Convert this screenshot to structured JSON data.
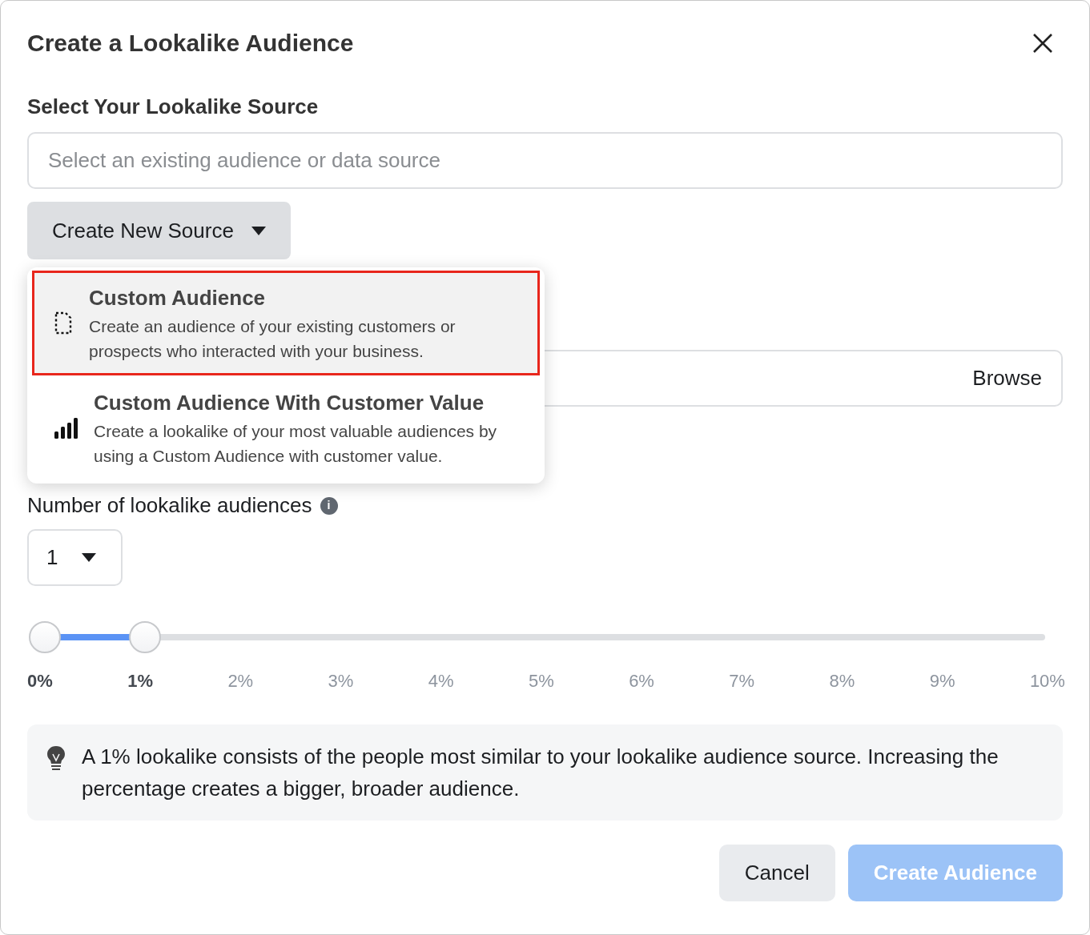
{
  "dialog": {
    "title": "Create a Lookalike Audience"
  },
  "source": {
    "label": "Select Your Lookalike Source",
    "placeholder": "Select an existing audience or data source"
  },
  "create_source_button": {
    "label": "Create New Source",
    "expanded": true
  },
  "menu": [
    {
      "kind": "document",
      "title": "Custom Audience",
      "description": "Create an audience of your existing customers or prospects who interacted with your business.",
      "highlighted": true
    },
    {
      "kind": "chart",
      "title": "Custom Audience With Customer Value",
      "description": "Create a lookalike of your most valuable audiences by using a Custom Audience with customer value.",
      "highlighted": false
    }
  ],
  "file_field": {
    "button": "Browse"
  },
  "count": {
    "label": "Number of lookalike audiences",
    "info": "i",
    "value": "1"
  },
  "size_slider": {
    "level": 0.1,
    "ticks": [
      {
        "label": "0%",
        "selected": true
      },
      {
        "label": "1%",
        "selected": true
      },
      {
        "label": "2%",
        "selected": false
      },
      {
        "label": "3%",
        "selected": false
      },
      {
        "label": "4%",
        "selected": false
      },
      {
        "label": "5%",
        "selected": false
      },
      {
        "label": "6%",
        "selected": false
      },
      {
        "label": "7%",
        "selected": false
      },
      {
        "label": "8%",
        "selected": false
      },
      {
        "label": "9%",
        "selected": false
      },
      {
        "label": "10%",
        "selected": false
      }
    ]
  },
  "tip": "A 1% lookalike consists of the people most similar to your lookalike audience source. Increasing the percentage creates a bigger, broader audience.",
  "buttons": [
    {
      "kind": "secondary",
      "label": "Cancel",
      "disabled": false
    },
    {
      "kind": "primary",
      "label": "Create Audience",
      "disabled": true
    }
  ]
}
